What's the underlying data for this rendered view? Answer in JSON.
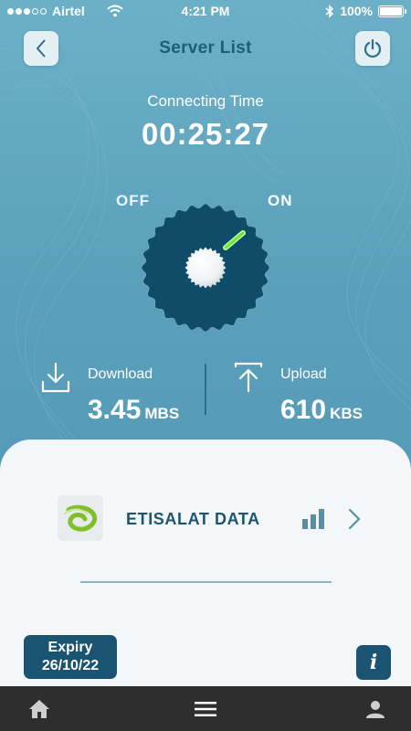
{
  "status_bar": {
    "carrier": "Airtel",
    "time": "4:21 PM",
    "battery": "100%",
    "battery_level": 1.0,
    "signal_dots_filled": 3,
    "signal_dots_total": 5
  },
  "header": {
    "title": "Server List",
    "back_icon": "chevron-left-icon",
    "power_icon": "power-icon"
  },
  "connection": {
    "timer_label": "Connecting Time",
    "timer_value": "00:25:27",
    "toggle_off_label": "OFF",
    "toggle_on_label": "ON",
    "state": "on"
  },
  "stats": {
    "download": {
      "label": "Download",
      "value": "3.45",
      "unit": "MBS"
    },
    "upload": {
      "label": "Upload",
      "value": "610",
      "unit": "KBS"
    }
  },
  "server": {
    "name": "ETISALAT DATA",
    "logo_icon": "etisalat-logo-icon"
  },
  "footer": {
    "expiry_label": "Expiry",
    "expiry_date": "26/10/22",
    "info_label": "i"
  },
  "nav": {
    "home_icon": "home-icon",
    "menu_icon": "menu-icon",
    "profile_icon": "profile-icon"
  },
  "colors": {
    "background": "#5a9fbb",
    "primary": "#1a5472",
    "accent_green": "#7ee84a",
    "panel": "#f4f7f9"
  }
}
